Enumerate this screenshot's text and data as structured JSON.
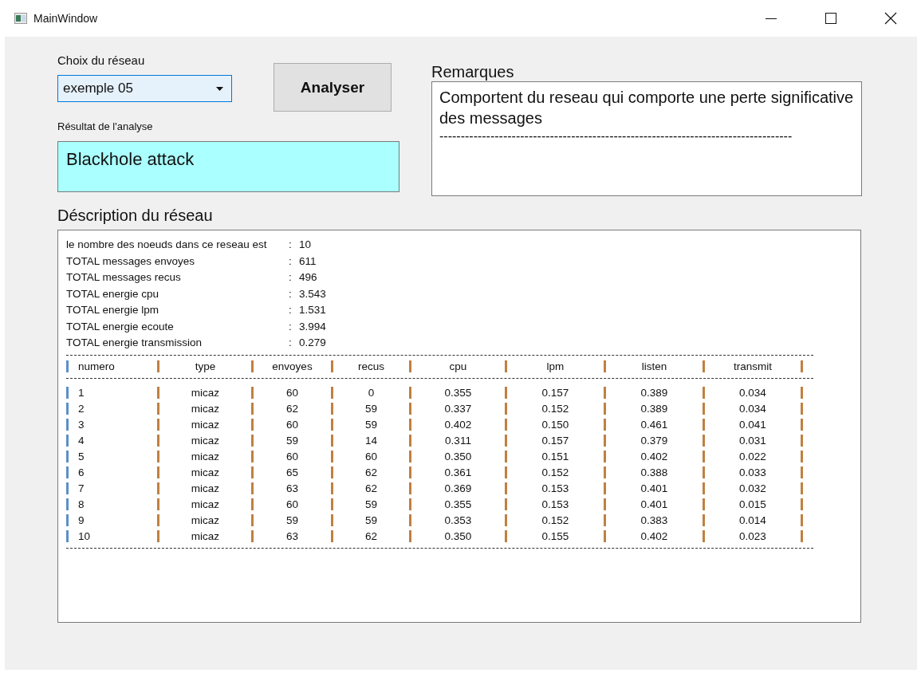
{
  "window": {
    "title": "MainWindow"
  },
  "network_choice": {
    "label": "Choix du réseau",
    "value": "exemple 05"
  },
  "analyze_button": "Analyser",
  "result": {
    "label": "Résultat de l'analyse",
    "value": "Blackhole attack"
  },
  "remarks": {
    "label": "Remarques",
    "lines": [
      "Comportent du reseau qui comporte une perte significative",
      "des messages",
      "-----------------------------------------------------------------------------------"
    ]
  },
  "description": {
    "label": "Déscription du réseau",
    "summary": [
      {
        "label": "le nombre des noeuds dans ce reseau est",
        "sep": ":",
        "value": "10"
      },
      {
        "label": "TOTAL messages envoyes",
        "sep": ":",
        "value": "611"
      },
      {
        "label": "TOTAL messages recus",
        "sep": ":",
        "value": "496"
      },
      {
        "label": "TOTAL energie cpu",
        "sep": ":",
        "value": "3.543"
      },
      {
        "label": "TOTAL energie lpm",
        "sep": ":",
        "value": "1.531"
      },
      {
        "label": "TOTAL energie ecoute",
        "sep": ":",
        "value": "3.994"
      },
      {
        "label": "TOTAL energie transmission",
        "sep": ":",
        "value": "0.279"
      }
    ],
    "table": {
      "columns": [
        "numero",
        "type",
        "envoyes",
        "recus",
        "cpu",
        "lpm",
        "listen",
        "transmit"
      ],
      "rows": [
        [
          "1",
          "micaz",
          "60",
          "0",
          "0.355",
          "0.157",
          "0.389",
          "0.034"
        ],
        [
          "2",
          "micaz",
          "62",
          "59",
          "0.337",
          "0.152",
          "0.389",
          "0.034"
        ],
        [
          "3",
          "micaz",
          "60",
          "59",
          "0.402",
          "0.150",
          "0.461",
          "0.041"
        ],
        [
          "4",
          "micaz",
          "59",
          "14",
          "0.311",
          "0.157",
          "0.379",
          "0.031"
        ],
        [
          "5",
          "micaz",
          "60",
          "60",
          "0.350",
          "0.151",
          "0.402",
          "0.022"
        ],
        [
          "6",
          "micaz",
          "65",
          "62",
          "0.361",
          "0.152",
          "0.388",
          "0.033"
        ],
        [
          "7",
          "micaz",
          "63",
          "62",
          "0.369",
          "0.153",
          "0.401",
          "0.032"
        ],
        [
          "8",
          "micaz",
          "60",
          "59",
          "0.355",
          "0.153",
          "0.401",
          "0.015"
        ],
        [
          "9",
          "micaz",
          "59",
          "59",
          "0.353",
          "0.152",
          "0.383",
          "0.014"
        ],
        [
          "10",
          "micaz",
          "63",
          "62",
          "0.350",
          "0.155",
          "0.402",
          "0.023"
        ]
      ]
    }
  }
}
